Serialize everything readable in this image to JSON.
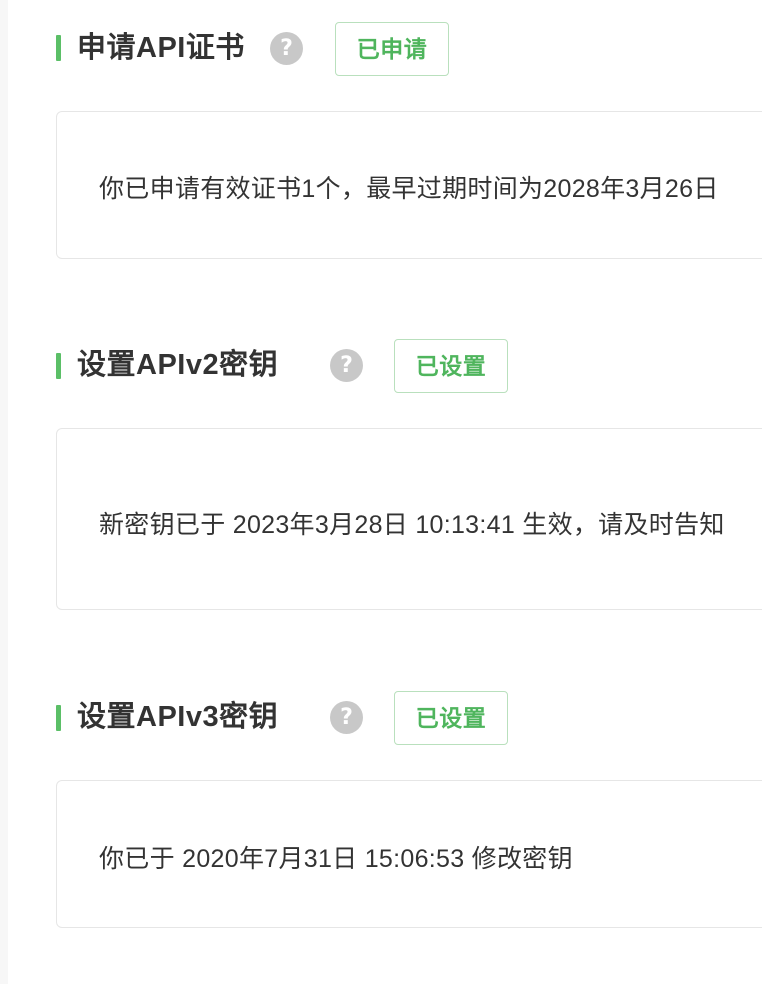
{
  "colors": {
    "accent": "#5bbf67",
    "badge_text": "#4fb55d",
    "badge_border": "#b9e0bd",
    "help_icon": "#c8c8c8",
    "card_border": "#e6e6e6"
  },
  "sections": [
    {
      "title": "申请API证书",
      "help_icon": "question-circle-icon",
      "help_symbol": "?",
      "status": "已申请",
      "info": "你已申请有效证书1个，最早过期时间为2028年3月26日"
    },
    {
      "title": "设置APIv2密钥",
      "help_icon": "question-circle-icon",
      "help_symbol": "?",
      "status": "已设置",
      "info": "新密钥已于 2023年3月28日 10:13:41 生效，请及时告知"
    },
    {
      "title": "设置APIv3密钥",
      "help_icon": "question-circle-icon",
      "help_symbol": "?",
      "status": "已设置",
      "info": "你已于 2020年7月31日 15:06:53 修改密钥"
    }
  ]
}
